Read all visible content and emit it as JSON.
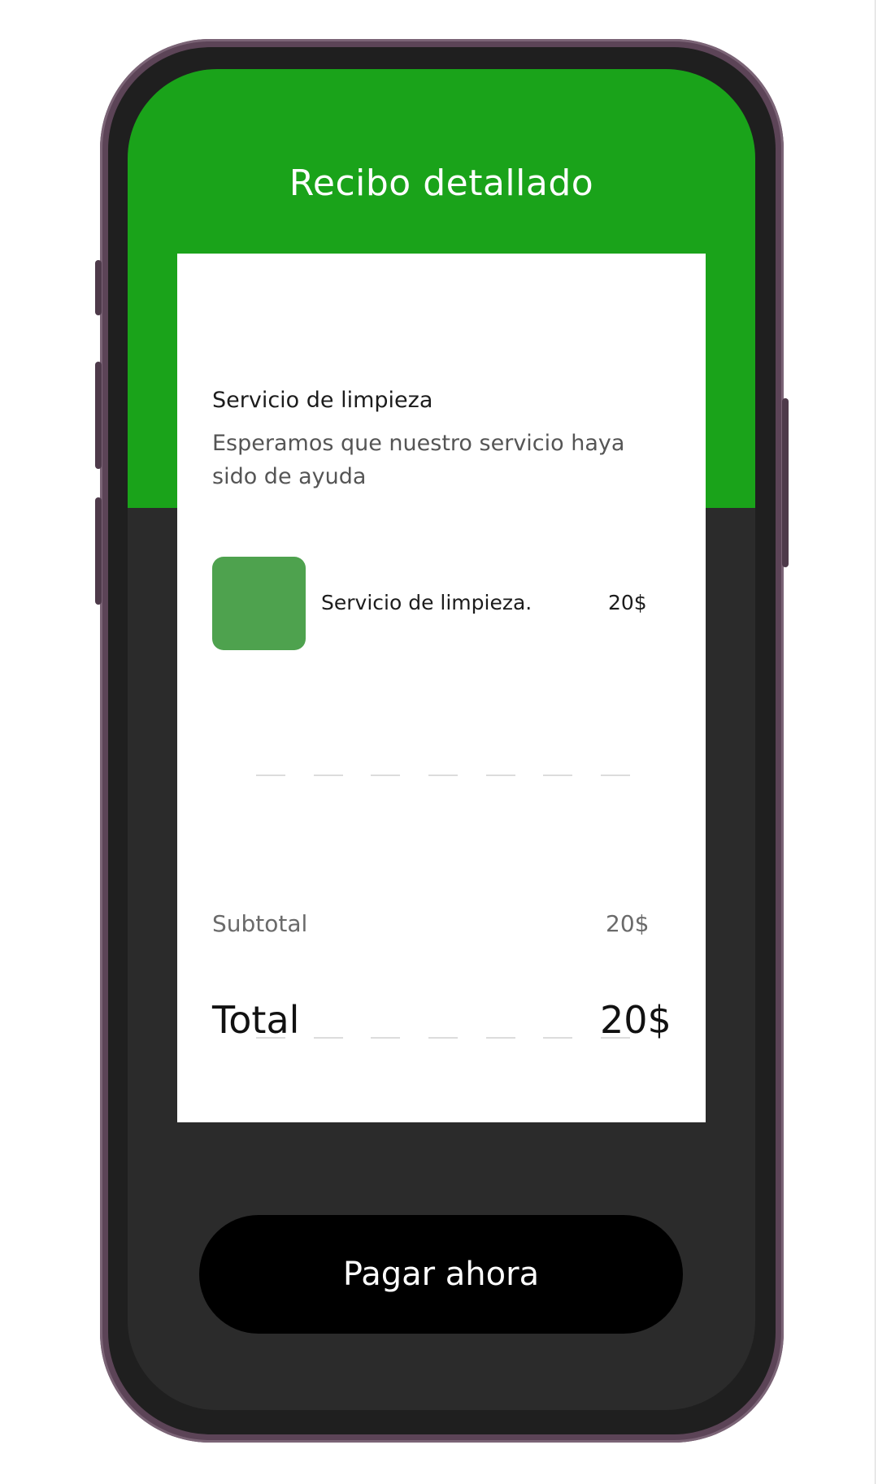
{
  "header": {
    "title": "Recibo detallado"
  },
  "receipt": {
    "service_title": "Servicio de limpieza",
    "service_description": "Esperamos que nuestro servicio haya sido de ayuda",
    "item": {
      "name": "Servicio de limpieza.",
      "price": "20$"
    },
    "subtotal_label": "Subtotal",
    "subtotal_value": "20$",
    "total_label": "Total",
    "total_value": "20$"
  },
  "actions": {
    "pay_label": "Pagar ahora"
  },
  "colors": {
    "header_green": "#1aa31a",
    "thumb_green": "#4ea24e",
    "screen_dark": "#2b2b2b",
    "phone_frame": "#5c4457"
  }
}
